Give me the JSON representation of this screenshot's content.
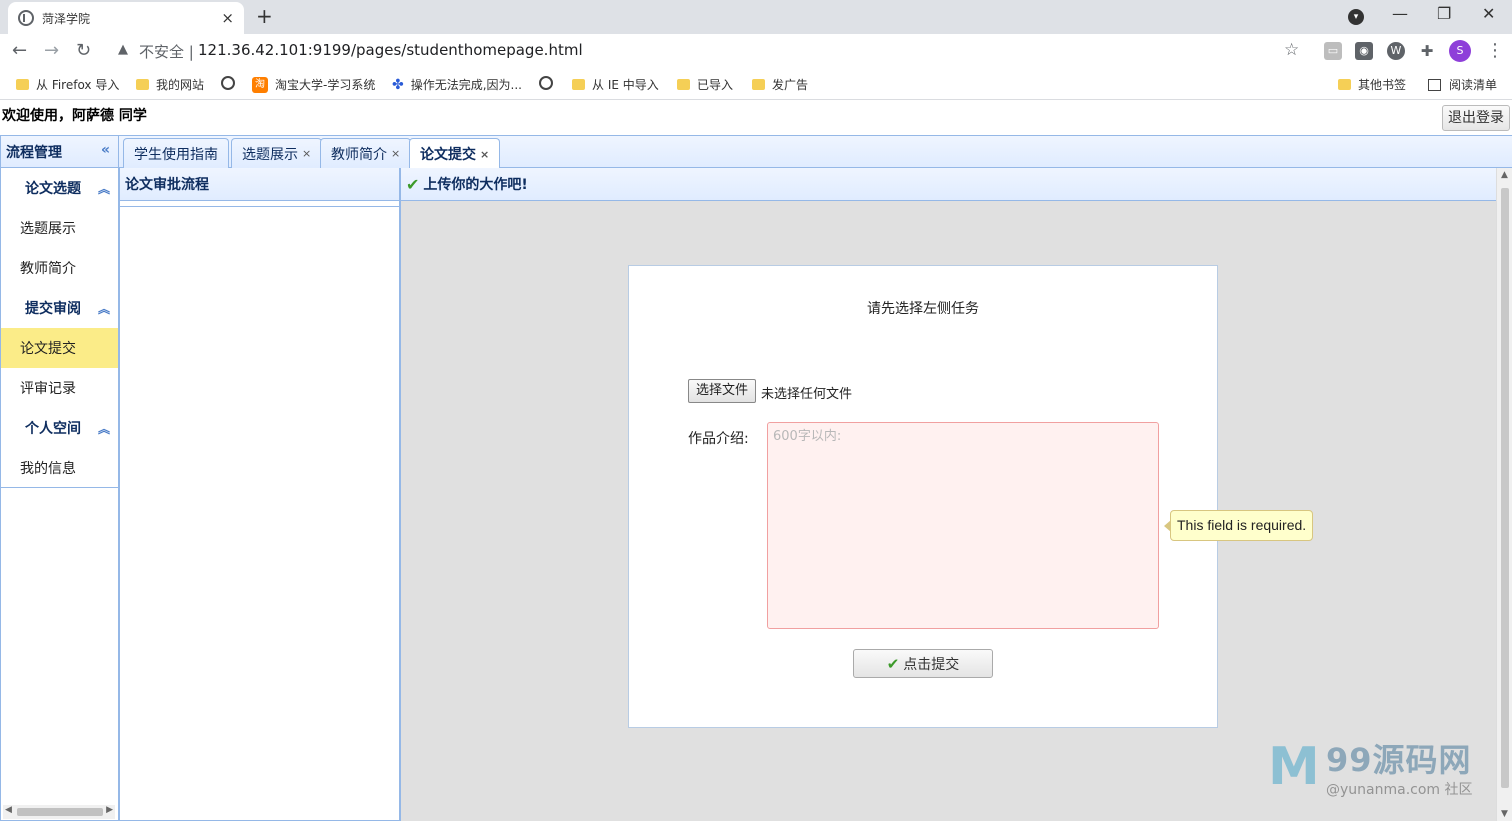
{
  "browser": {
    "tab_title": "菏泽学院",
    "tab_close": "×",
    "new_tab": "+",
    "insecure_label": "不安全 |",
    "url": "121.36.42.101:9199/pages/studenthomepage.html",
    "profile_initial": "S"
  },
  "bookmarks": [
    "从 Firefox 导入",
    "我的网站",
    "淘宝大学-学习系统",
    "操作无法完成,因为...",
    "从 IE 中导入",
    "已导入",
    "发广告",
    "其他书签",
    "阅读清单"
  ],
  "page": {
    "welcome": "欢迎使用，阿萨德 同学",
    "logout_label": "退出登录"
  },
  "sidebar": {
    "title": "流程管理",
    "groups": [
      {
        "label": "论文选题",
        "items": [
          "选题展示",
          "教师简介"
        ]
      },
      {
        "label": "提交审阅",
        "items": [
          "论文提交",
          "评审记录"
        ]
      },
      {
        "label": "个人空间",
        "items": [
          "我的信息"
        ]
      }
    ],
    "active_item": "论文提交"
  },
  "tabs": [
    {
      "label": "学生使用指南",
      "closable": false
    },
    {
      "label": "选题展示",
      "closable": true
    },
    {
      "label": "教师简介",
      "closable": true
    },
    {
      "label": "论文提交",
      "closable": true,
      "active": true
    }
  ],
  "tab_close_glyph": "×",
  "middle_panel": {
    "title": "论文审批流程"
  },
  "content": {
    "header": "上传你的大作吧!",
    "form_title": "请先选择左侧任务",
    "file_button": "选择文件",
    "file_status": "未选择任何文件",
    "intro_label": "作品介绍:",
    "intro_placeholder": "600字以内:",
    "submit_label": "点击提交",
    "validation_tooltip": "This field is required."
  },
  "watermark": {
    "logo": "M",
    "text": "99源码网",
    "subtext": "@yunanma.com 社区"
  },
  "colors": {
    "panel_border": "#95b8e7",
    "header_text": "#0e2d5f",
    "active_item_bg": "#fbec88",
    "content_bg": "#e0e0e0",
    "textarea_bg": "#fff1f0"
  }
}
